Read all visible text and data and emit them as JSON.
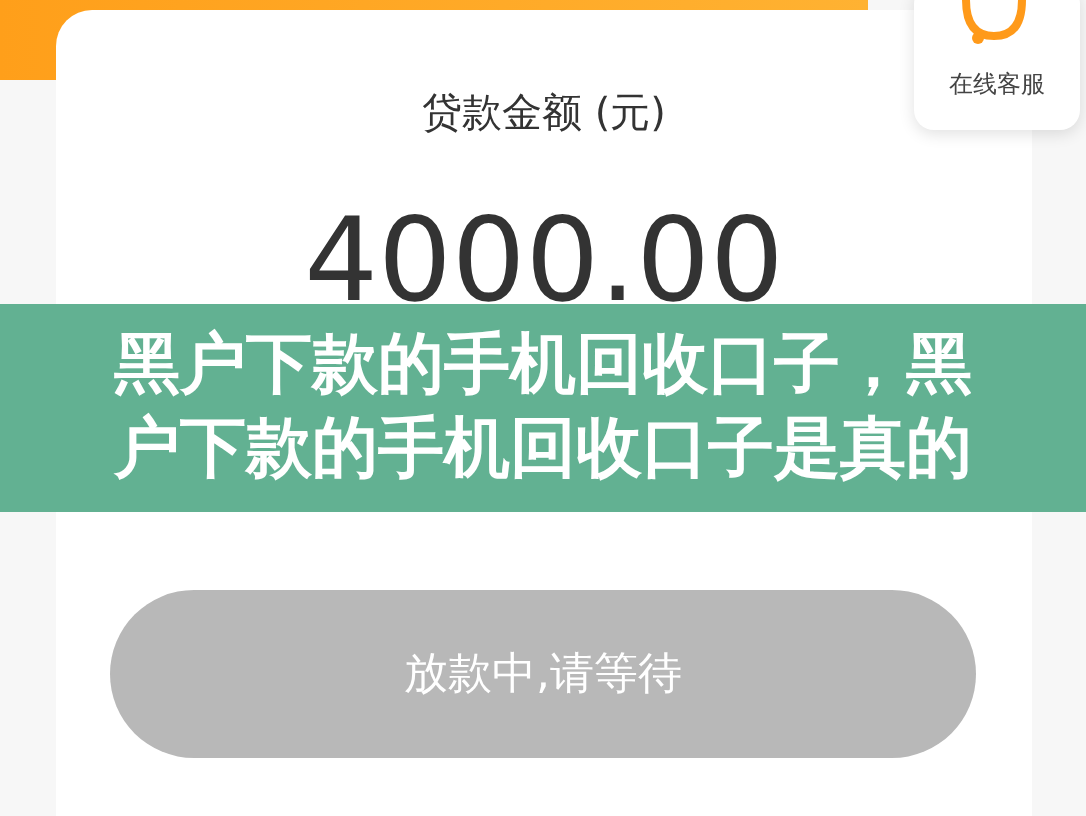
{
  "support_button": {
    "label": "在线客服"
  },
  "loan": {
    "label": "贷款金额 (元)",
    "amount": "4000.00"
  },
  "action_button": {
    "label": "放款中,请等待",
    "disabled": true
  },
  "title_banner": {
    "text": "黑户下款的手机回收口子，黑户下款的手机回收口子是真的"
  }
}
